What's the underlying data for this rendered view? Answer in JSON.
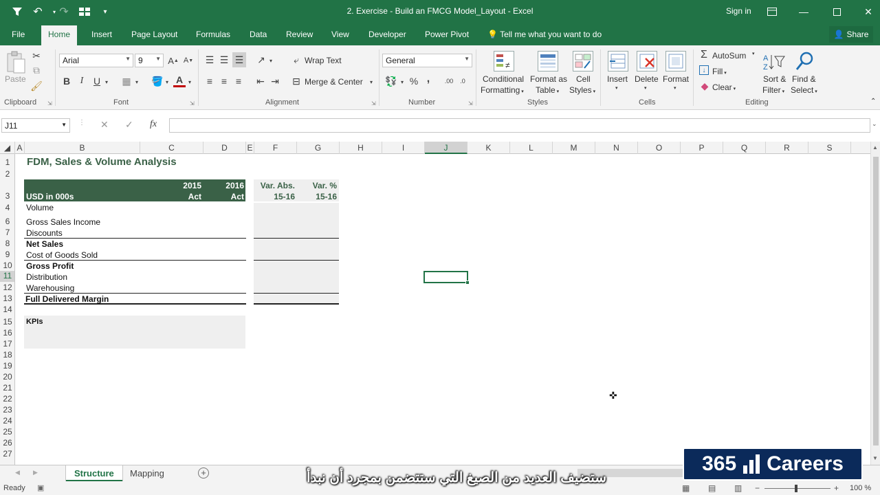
{
  "window": {
    "title": "2. Exercise - Build an FMCG Model_Layout - Excel",
    "sign_in": "Sign in"
  },
  "menu": {
    "tabs": [
      "File",
      "Home",
      "Insert",
      "Page Layout",
      "Formulas",
      "Data",
      "Review",
      "View",
      "Developer",
      "Power Pivot"
    ],
    "active_tab": "Home",
    "tell_me": "Tell me what you want to do",
    "share": "Share"
  },
  "ribbon": {
    "clipboard": {
      "paste": "Paste",
      "label": "Clipboard"
    },
    "font": {
      "name": "Arial",
      "size": "9",
      "bold": "B",
      "italic": "I",
      "underline": "U",
      "label": "Font"
    },
    "alignment": {
      "wrap_text": "Wrap Text",
      "merge_center": "Merge & Center",
      "label": "Alignment"
    },
    "number": {
      "format": "General",
      "percent": "%",
      "comma": ",",
      "label": "Number"
    },
    "styles": {
      "conditional_1": "Conditional",
      "conditional_2": "Formatting",
      "format_table_1": "Format as",
      "format_table_2": "Table",
      "cell_styles_1": "Cell",
      "cell_styles_2": "Styles",
      "label": "Styles"
    },
    "cells": {
      "insert": "Insert",
      "delete": "Delete",
      "format": "Format",
      "label": "Cells"
    },
    "editing": {
      "autosum": "AutoSum",
      "fill": "Fill",
      "clear": "Clear",
      "sort_1": "Sort &",
      "sort_2": "Filter",
      "find_1": "Find &",
      "find_2": "Select",
      "label": "Editing"
    }
  },
  "formula_bar": {
    "name_box": "J11",
    "fx": "fx",
    "value": ""
  },
  "columns": [
    "A",
    "B",
    "C",
    "D",
    "E",
    "F",
    "G",
    "H",
    "I",
    "J",
    "K",
    "L",
    "M",
    "N",
    "O",
    "P",
    "Q",
    "R",
    "S"
  ],
  "selected_column": "J",
  "rows": [
    "1",
    "2",
    "3",
    "4",
    "6",
    "7",
    "8",
    "9",
    "10",
    "11",
    "12",
    "13",
    "14",
    "15",
    "16",
    "17",
    "18",
    "19",
    "20",
    "21",
    "22",
    "23",
    "24",
    "25",
    "26",
    "27"
  ],
  "selected_row": "11",
  "sheet": {
    "title": "FDM, Sales & Volume Analysis",
    "header": {
      "currency": "USD in 000s",
      "year_2015": "2015",
      "act_2015": "Act",
      "year_2016": "2016",
      "act_2016": "Act",
      "var_abs": "Var. Abs.",
      "var_abs_period": "15-16",
      "var_pct": "Var. %",
      "var_pct_period": "15-16"
    },
    "line_items": {
      "volume": "Volume",
      "gross_sales": "Gross Sales Income",
      "discounts": "Discounts",
      "net_sales": "Net Sales",
      "cogs": "Cost of Goods Sold",
      "gross_profit": "Gross Profit",
      "distribution": "Distribution",
      "warehousing": "Warehousing",
      "fdm": "Full Delivered Margin"
    },
    "kpis": "KPIs"
  },
  "sheet_tabs": [
    "Structure",
    "Mapping"
  ],
  "active_sheet": "Structure",
  "status": {
    "ready": "Ready",
    "zoom": "100 %"
  },
  "overlay": {
    "logo": "365 Careers",
    "subtitle": "ستضيف العديد من الصيغ التي ستتضمن بمجرد أن نبدأ"
  },
  "colors": {
    "excel_green": "#217346",
    "table_header": "#3a6147"
  }
}
